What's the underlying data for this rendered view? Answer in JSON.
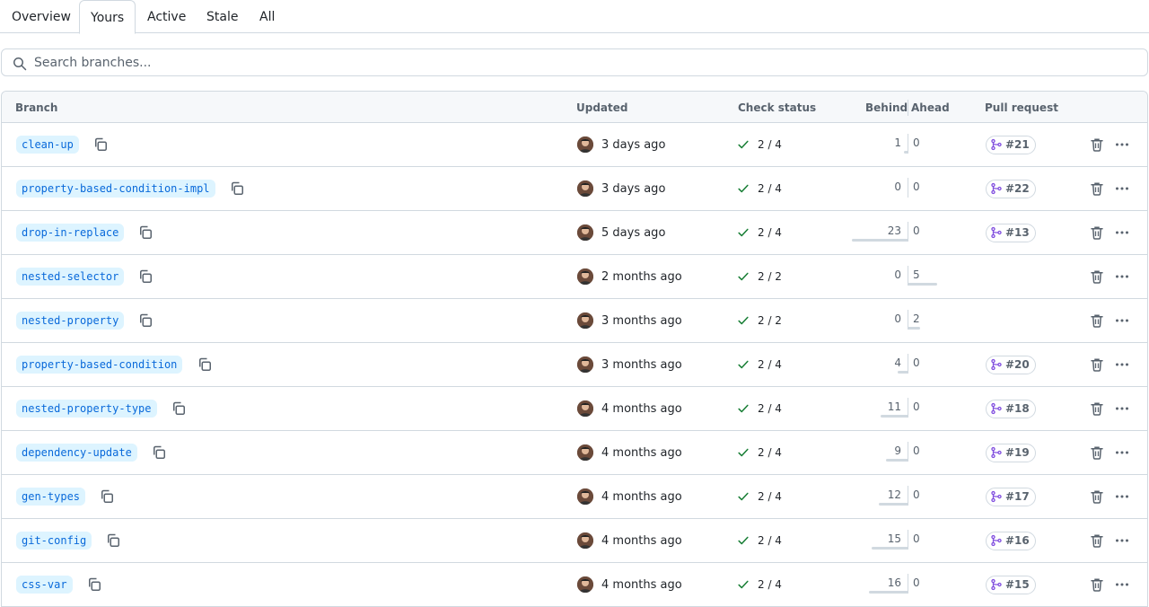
{
  "tabs": [
    {
      "label": "Overview"
    },
    {
      "label": "Yours",
      "selected": true
    },
    {
      "label": "Active"
    },
    {
      "label": "Stale"
    },
    {
      "label": "All"
    }
  ],
  "search": {
    "placeholder": "Search branches..."
  },
  "columns": {
    "branch": "Branch",
    "updated": "Updated",
    "check_status": "Check status",
    "behind": "Behind",
    "ahead": "Ahead",
    "pull_request": "Pull request"
  },
  "colors": {
    "accent": "#0969da",
    "branch_bg": "#ddf4ff",
    "success": "#1a7f37",
    "pr_icon": "#8250df",
    "border": "#d1d9e0"
  },
  "icons": {
    "search": "search-icon",
    "copy": "copy-icon",
    "check": "check-icon",
    "pr": "git-pull-request-icon",
    "trash": "trash-icon",
    "menu": "kebab-horizontal-icon"
  },
  "rows": [
    {
      "branch": "clean-up",
      "updated": "3 days ago",
      "check": "2 / 4",
      "behind": "1",
      "ahead": "0",
      "pr": "#21"
    },
    {
      "branch": "property-based-condition-impl",
      "updated": "3 days ago",
      "check": "2 / 4",
      "behind": "0",
      "ahead": "0",
      "pr": "#22"
    },
    {
      "branch": "drop-in-replace",
      "updated": "5 days ago",
      "check": "2 / 4",
      "behind": "23",
      "ahead": "0",
      "pr": "#13"
    },
    {
      "branch": "nested-selector",
      "updated": "2 months ago",
      "check": "2 / 2",
      "behind": "0",
      "ahead": "5",
      "pr": ""
    },
    {
      "branch": "nested-property",
      "updated": "3 months ago",
      "check": "2 / 2",
      "behind": "0",
      "ahead": "2",
      "pr": ""
    },
    {
      "branch": "property-based-condition",
      "updated": "3 months ago",
      "check": "2 / 4",
      "behind": "4",
      "ahead": "0",
      "pr": "#20"
    },
    {
      "branch": "nested-property-type",
      "updated": "4 months ago",
      "check": "2 / 4",
      "behind": "11",
      "ahead": "0",
      "pr": "#18"
    },
    {
      "branch": "dependency-update",
      "updated": "4 months ago",
      "check": "2 / 4",
      "behind": "9",
      "ahead": "0",
      "pr": "#19"
    },
    {
      "branch": "gen-types",
      "updated": "4 months ago",
      "check": "2 / 4",
      "behind": "12",
      "ahead": "0",
      "pr": "#17"
    },
    {
      "branch": "git-config",
      "updated": "4 months ago",
      "check": "2 / 4",
      "behind": "15",
      "ahead": "0",
      "pr": "#16"
    },
    {
      "branch": "css-var",
      "updated": "4 months ago",
      "check": "2 / 4",
      "behind": "16",
      "ahead": "0",
      "pr": "#15"
    }
  ]
}
